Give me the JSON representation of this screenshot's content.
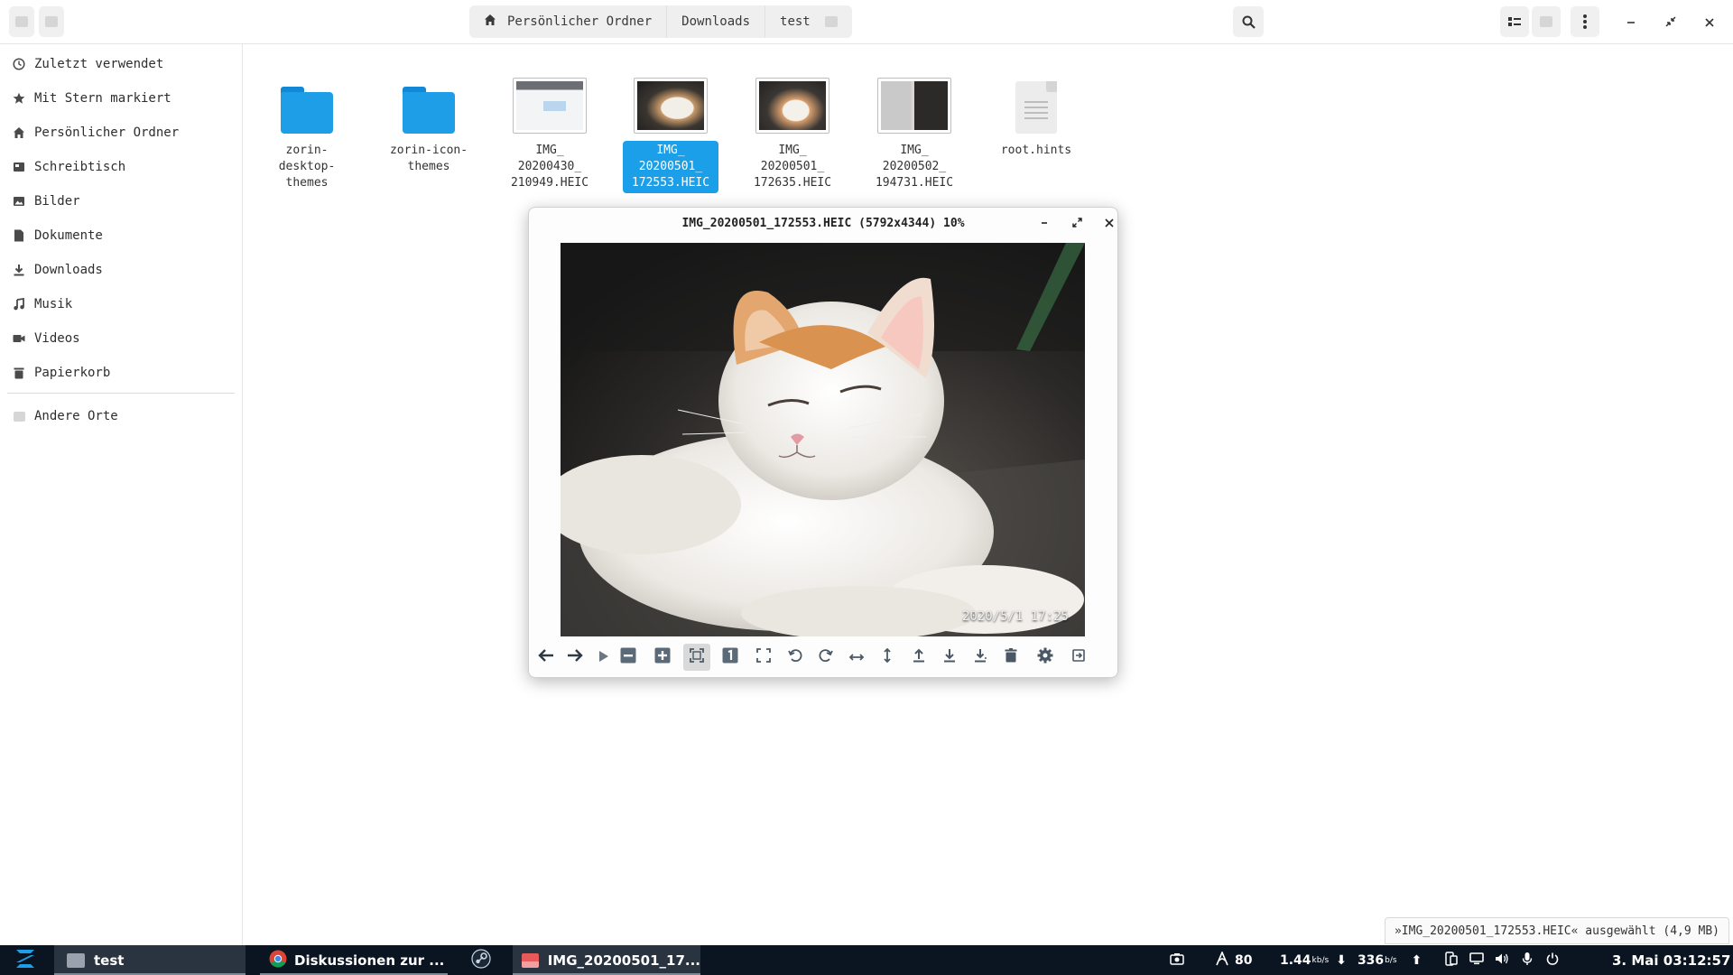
{
  "header": {
    "breadcrumb": [
      "Persönlicher Ordner",
      "Downloads",
      "test"
    ]
  },
  "sidebar": {
    "items": [
      {
        "label": "Zuletzt verwendet",
        "icon": "clock-icon"
      },
      {
        "label": "Mit Stern markiert",
        "icon": "star-icon"
      },
      {
        "label": "Persönlicher Ordner",
        "icon": "home-icon"
      },
      {
        "label": "Schreibtisch",
        "icon": "desktop-icon"
      },
      {
        "label": "Bilder",
        "icon": "image-icon"
      },
      {
        "label": "Dokumente",
        "icon": "document-icon"
      },
      {
        "label": "Downloads",
        "icon": "download-icon"
      },
      {
        "label": "Musik",
        "icon": "music-icon"
      },
      {
        "label": "Videos",
        "icon": "video-icon"
      },
      {
        "label": "Papierkorb",
        "icon": "trash-icon"
      }
    ],
    "other": {
      "label": "Andere Orte",
      "icon": "plus-icon"
    }
  },
  "files": [
    {
      "name": "zorin-\ndesktop-\nthemes",
      "kind": "folder"
    },
    {
      "name": "zorin-icon-\nthemes",
      "kind": "folder"
    },
    {
      "name": "IMG_\n20200430_\n210949.HEIC",
      "kind": "image"
    },
    {
      "name": "IMG_\n20200501_\n172553.HEIC",
      "kind": "image",
      "selected": true
    },
    {
      "name": "IMG_\n20200501_\n172635.HEIC",
      "kind": "image"
    },
    {
      "name": "IMG_\n20200502_\n194731.HEIC",
      "kind": "image"
    },
    {
      "name": "root.hints",
      "kind": "text"
    }
  ],
  "viewer": {
    "title": "IMG_20200501_172553.HEIC (5792x4344) 10%",
    "timestamp": "2020/5/1  17:25"
  },
  "status": "»IMG_20200501_172553.HEIC« ausgewählt (4,9 MB)",
  "taskbar": {
    "tasks": [
      "test",
      "Diskussionen zur ...",
      "IMG_20200501_17..."
    ],
    "tray": {
      "cpu": "80",
      "down_value": "1.44",
      "down_unit": "kb/s",
      "up_value": "336",
      "up_unit": "b/s",
      "clock": "3. Mai  03:12:57"
    }
  },
  "colors": {
    "accent": "#1a9fe8",
    "folder": "#1e9ee6",
    "taskbar": "#0a1521"
  }
}
